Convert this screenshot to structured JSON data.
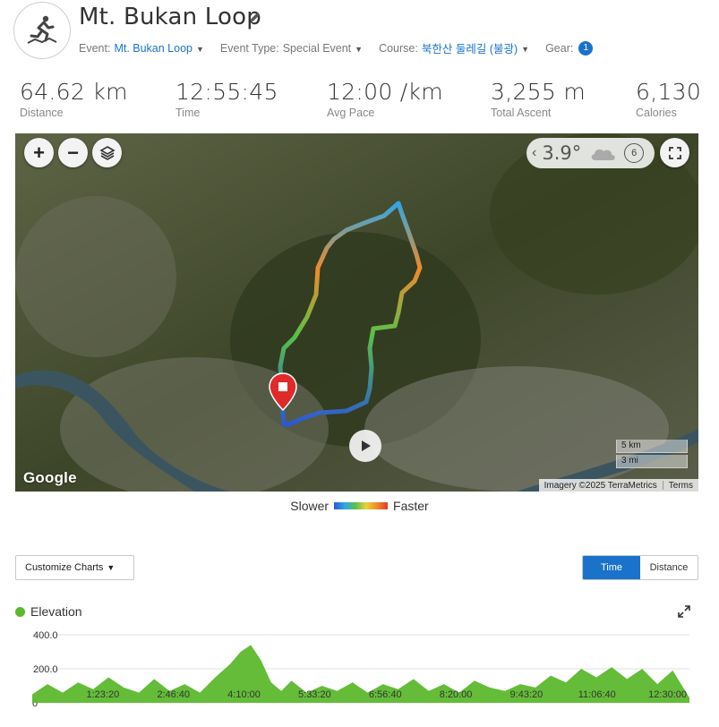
{
  "activity": {
    "title": "Mt. Bukan Loop",
    "icon": "trail-runner-icon"
  },
  "meta": {
    "event_label": "Event:",
    "event_value": "Mt. Bukan Loop",
    "event_type_label": "Event Type:",
    "event_type_value": "Special Event",
    "course_label": "Course:",
    "course_value": "북한산 둘레길 (불광)",
    "gear_label": "Gear:",
    "gear_count": "1"
  },
  "stats": [
    {
      "value": "64.62 km",
      "label": "Distance"
    },
    {
      "value": "12:55:45",
      "label": "Time"
    },
    {
      "value": "12:00 /km",
      "label": "Avg Pace"
    },
    {
      "value": "3,255 m",
      "label": "Total Ascent"
    },
    {
      "value": "6,130",
      "label": "Calories"
    }
  ],
  "map": {
    "weather_temp": "3.9°",
    "weather_icon": "cloud-icon",
    "wind_value": "6",
    "scale_km": "5 km",
    "scale_mi": "3 mi",
    "google_logo": "Google",
    "attribution": "Imagery ©2025 TerraMetrics",
    "terms": "Terms"
  },
  "legend": {
    "slower": "Slower",
    "faster": "Faster"
  },
  "controls": {
    "customize_label": "Customize Charts",
    "toggle_time": "Time",
    "toggle_distance": "Distance"
  },
  "elevation": {
    "title": "Elevation",
    "color": "#5cb82e"
  },
  "chart_data": {
    "type": "area",
    "title": "Elevation",
    "xlabel": "",
    "ylabel": "",
    "y_ticks": [
      "400.0",
      "200.0",
      "0"
    ],
    "x_ticks": [
      "1:23:20",
      "2:46:40",
      "4:10:00",
      "5:33:20",
      "6:56:40",
      "8:20:00",
      "9:43:20",
      "11:06:40",
      "12:30:00"
    ],
    "ylim": [
      0,
      450
    ],
    "x_hours": [
      0,
      0.3,
      0.6,
      0.9,
      1.2,
      1.5,
      1.8,
      2.1,
      2.4,
      2.7,
      3.0,
      3.3,
      3.6,
      3.9,
      4.1,
      4.3,
      4.5,
      4.7,
      4.9,
      5.1,
      5.4,
      5.7,
      6.0,
      6.3,
      6.6,
      6.9,
      7.2,
      7.5,
      7.8,
      8.1,
      8.4,
      8.7,
      9.0,
      9.3,
      9.6,
      9.9,
      10.2,
      10.5,
      10.8,
      11.1,
      11.4,
      11.7,
      12.0,
      12.3,
      12.6,
      12.93
    ],
    "values": [
      50,
      110,
      60,
      120,
      80,
      150,
      90,
      60,
      140,
      70,
      110,
      60,
      150,
      230,
      300,
      340,
      250,
      120,
      70,
      130,
      60,
      100,
      70,
      120,
      60,
      110,
      80,
      140,
      70,
      110,
      60,
      130,
      90,
      70,
      110,
      90,
      160,
      120,
      200,
      150,
      210,
      140,
      200,
      110,
      190,
      30
    ]
  }
}
